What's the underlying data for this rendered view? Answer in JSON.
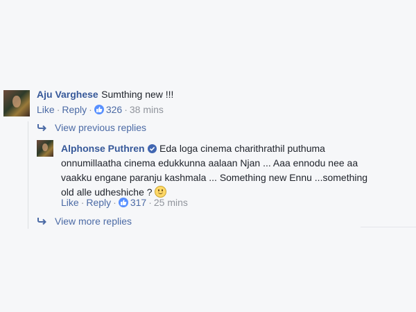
{
  "colors": {
    "name": "#365899",
    "link": "#4b6aa5",
    "meta": "#90949c",
    "like": "#5890ff",
    "background": "#f6f7f9"
  },
  "comment": {
    "author": "Aju Varghese",
    "text": "Sumthing new !!!",
    "like_label": "Like",
    "reply_label": "Reply",
    "reactions": "326",
    "time": "38 mins"
  },
  "thread": {
    "view_previous": "View previous replies",
    "view_more": "View more replies"
  },
  "reply": {
    "author": "Alphonse Puthren",
    "verified_icon": "verified-badge-icon",
    "text_lines": [
      "Eda loga cinema charithrathil puthuma",
      "onnumillaatha cinema edukkunna aalaan Njan ... Aaa ennodu nee aa",
      "vaakku engane paranju kashmala ... Something new Ennu ...something",
      "old alle udheshiche ?"
    ],
    "emoji": "smile-emoji-icon",
    "like_label": "Like",
    "reply_label": "Reply",
    "reactions": "317",
    "time": "25 mins"
  }
}
